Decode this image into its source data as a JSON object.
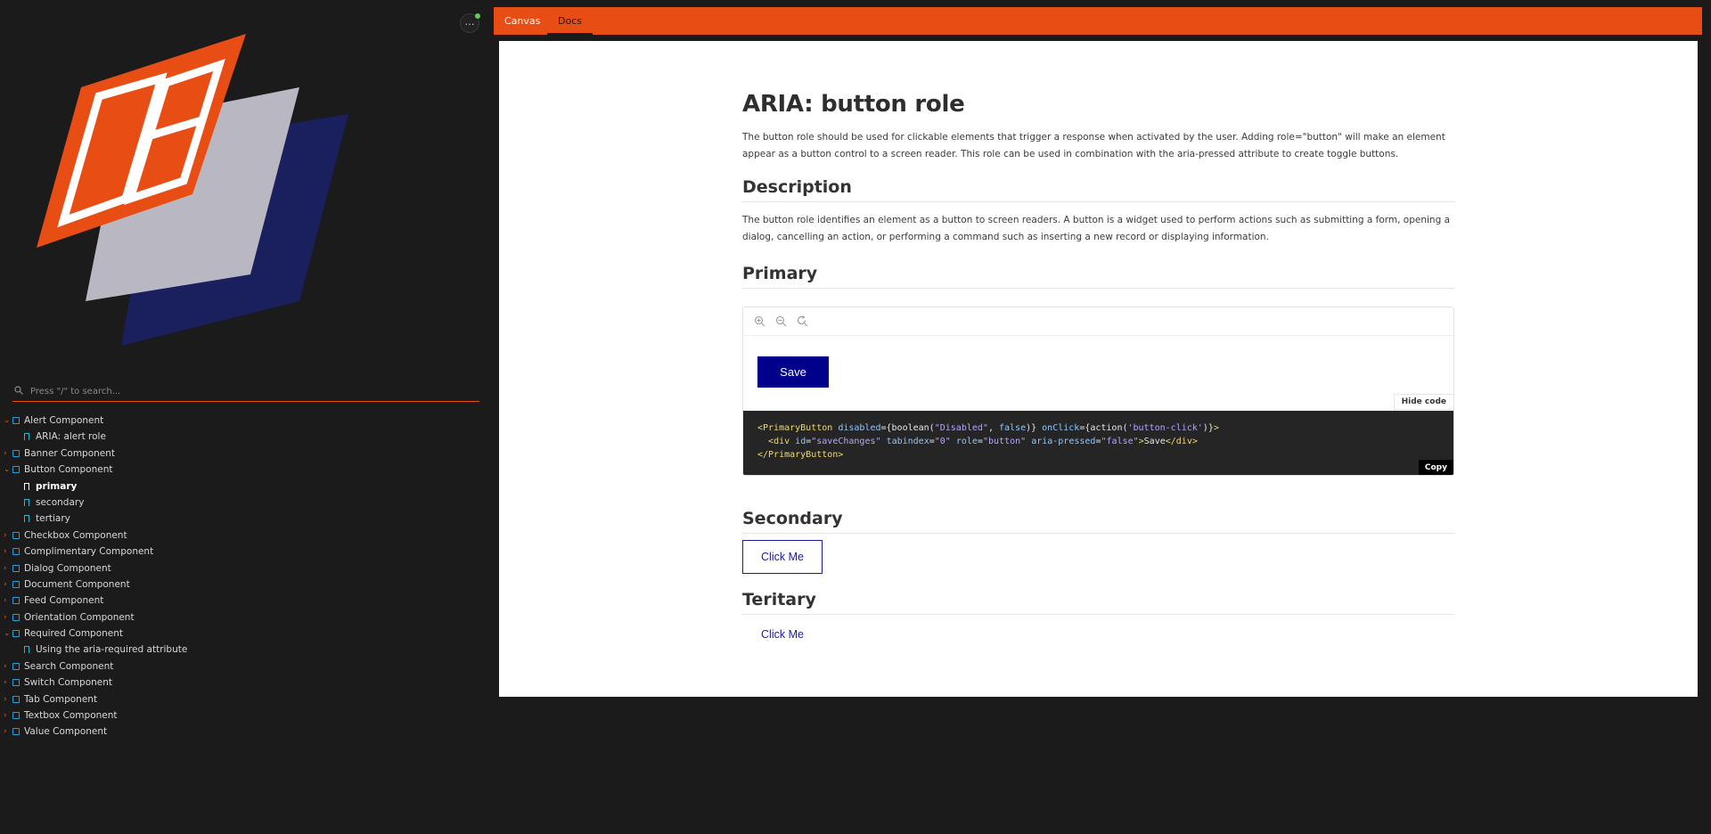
{
  "sidebar": {
    "menu_icon": "ellipsis-icon",
    "search": {
      "placeholder": "Press \"/\" to search..."
    },
    "tree": [
      {
        "label": "Alert Component",
        "type": "component",
        "expanded": true
      },
      {
        "label": "ARIA: alert role",
        "type": "story"
      },
      {
        "label": "Banner Component",
        "type": "component",
        "expanded": false
      },
      {
        "label": "Button Component",
        "type": "component",
        "expanded": true
      },
      {
        "label": "primary",
        "type": "story",
        "selected": true
      },
      {
        "label": "secondary",
        "type": "story"
      },
      {
        "label": "tertiary",
        "type": "story"
      },
      {
        "label": "Checkbox Component",
        "type": "component",
        "expanded": false
      },
      {
        "label": "Complimentary Component",
        "type": "component",
        "expanded": false
      },
      {
        "label": "Dialog Component",
        "type": "component",
        "expanded": false
      },
      {
        "label": "Document Component",
        "type": "component",
        "expanded": false
      },
      {
        "label": "Feed Component",
        "type": "component",
        "expanded": false
      },
      {
        "label": "Orientation Component",
        "type": "component",
        "expanded": false
      },
      {
        "label": "Required Component",
        "type": "component",
        "expanded": true
      },
      {
        "label": "Using the aria-required attribute",
        "type": "story"
      },
      {
        "label": "Search Component",
        "type": "component",
        "expanded": false
      },
      {
        "label": "Switch Component",
        "type": "component",
        "expanded": false
      },
      {
        "label": "Tab Component",
        "type": "component",
        "expanded": false
      },
      {
        "label": "Textbox Component",
        "type": "component",
        "expanded": false
      },
      {
        "label": "Value Component",
        "type": "component",
        "expanded": false
      }
    ]
  },
  "tabs": {
    "canvas": "Canvas",
    "docs": "Docs",
    "active": "Docs"
  },
  "doc": {
    "title": "ARIA: button role",
    "intro": "The button role should be used for clickable elements that trigger a response when activated by the user. Adding role=\"button\" will make an element appear as a button control to a screen reader. This role can be used in combination with the aria-pressed attribute to create toggle buttons.",
    "description_heading": "Description",
    "description": "The button role identifies an element as a button to screen readers. A button is a widget used to perform actions such as submitting a form, opening a dialog, cancelling an action, or performing a command such as inserting a new record or displaying information.",
    "primary_heading": "Primary",
    "primary_button": "Save",
    "hide_code": "Hide code",
    "copy": "Copy",
    "code_lines": [
      "<PrimaryButton disabled={boolean(\"Disabled\", false)} onClick={action('button-click')}>",
      "  <div id=\"saveChanges\" tabindex=\"0\" role=\"button\" aria-pressed=\"false\">Save</div>",
      "</PrimaryButton>"
    ],
    "secondary_heading": "Secondary",
    "secondary_button": "Click Me",
    "tertiary_heading": "Teritary",
    "tertiary_button": "Click Me"
  },
  "colors": {
    "accent": "#e84d14",
    "primary_button": "#00008b",
    "sidebar_bg": "#1b1b1b"
  }
}
